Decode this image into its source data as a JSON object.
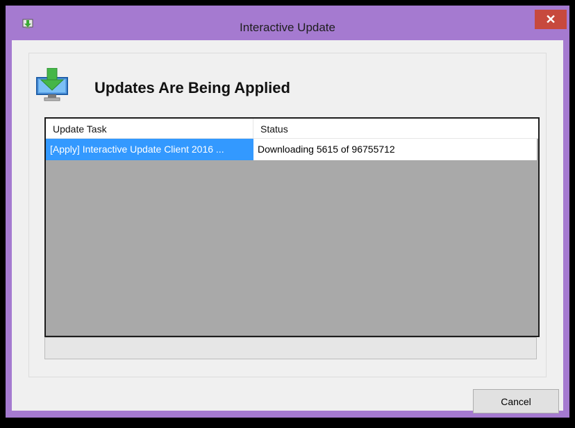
{
  "window": {
    "title": "Interactive Update",
    "close_glyph": "✕",
    "frame_color": "#a57ad0",
    "close_color": "#c7493d"
  },
  "header": {
    "title": "Updates Are Being Applied",
    "icon": "monitor-download-arrow-icon"
  },
  "table": {
    "columns": [
      "Update Task",
      "Status"
    ],
    "rows": [
      {
        "task": "[Apply] Interactive Update Client 2016 ...",
        "status": "Downloading 5615 of 96755712",
        "selected": true
      }
    ],
    "selection_color": "#3399ff"
  },
  "progress": {
    "value": 5615,
    "total": 96755712
  },
  "buttons": {
    "cancel": "Cancel"
  }
}
